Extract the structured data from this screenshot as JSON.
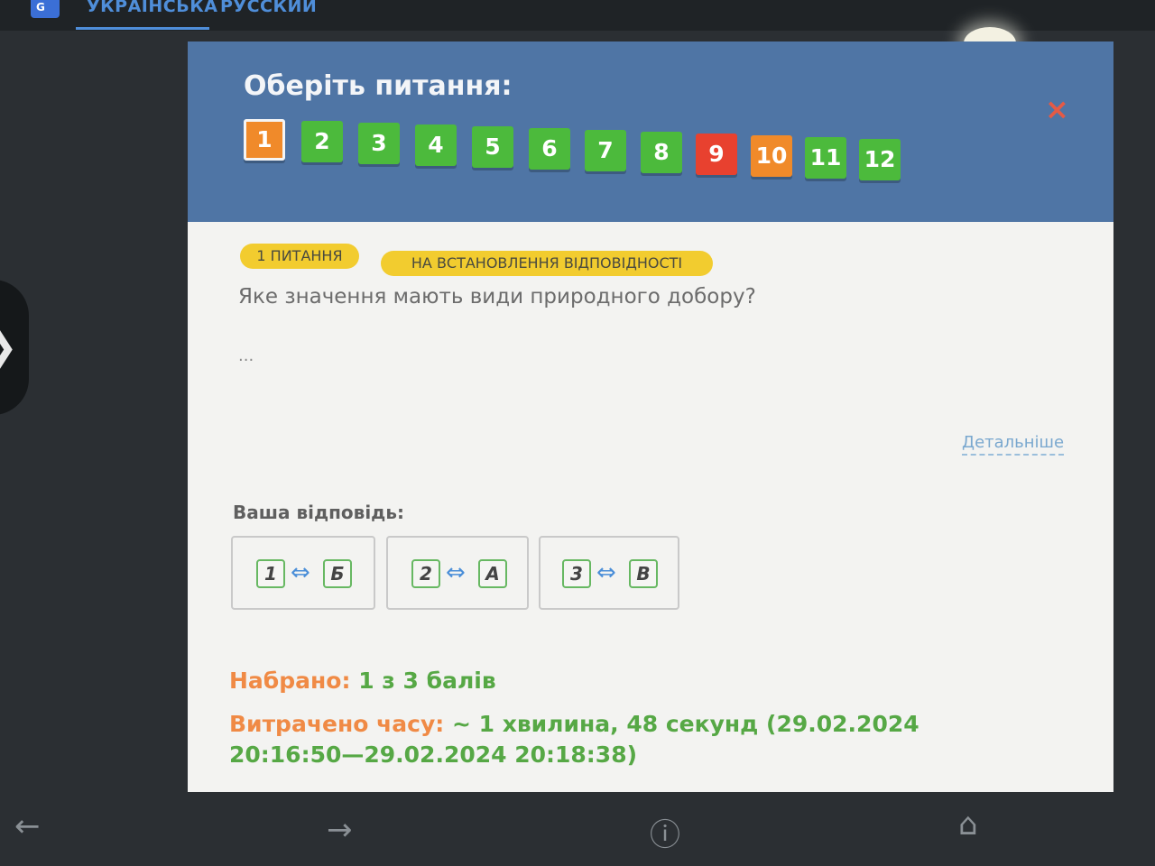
{
  "top_bar": {
    "languages": [
      "УКРАЇНСЬКА",
      "РУССКИЙ"
    ],
    "lang_icon": "G"
  },
  "modal": {
    "title": "Оберіть питання:",
    "close_icon": "×",
    "question_numbers": [
      {
        "label": "1",
        "status": "partial",
        "current": true
      },
      {
        "label": "2",
        "status": "correct"
      },
      {
        "label": "3",
        "status": "correct"
      },
      {
        "label": "4",
        "status": "correct"
      },
      {
        "label": "5",
        "status": "correct"
      },
      {
        "label": "6",
        "status": "correct"
      },
      {
        "label": "7",
        "status": "correct"
      },
      {
        "label": "8",
        "status": "correct"
      },
      {
        "label": "9",
        "status": "wrong"
      },
      {
        "label": "10",
        "status": "partial"
      },
      {
        "label": "11",
        "status": "correct"
      },
      {
        "label": "12",
        "status": "correct"
      }
    ],
    "badges": [
      "1 ПИТАННЯ",
      "НА ВСТАНОВЛЕННЯ ВІДПОВІДНОСТІ"
    ],
    "question_text": "Яке значення мають види природного добору?",
    "ellipsis": "...",
    "details_link": "Детальніше",
    "answer_label": "Ваша відповідь:",
    "pairs": [
      {
        "left": "1",
        "arrow": "⇔",
        "right": "Б"
      },
      {
        "left": "2",
        "arrow": "⇔",
        "right": "А"
      },
      {
        "left": "3",
        "arrow": "⇔",
        "right": "В"
      }
    ],
    "score_label": "Набрано:",
    "score_value": "1 з 3 балів",
    "time_label": "Витрачено часу:",
    "time_value": "~ 1 хвилина, 48 секунд (29.02.2024 20:16:50—29.02.2024 20:18:38)"
  },
  "colors": {
    "correct": "#4cba3c",
    "wrong": "#e8412f",
    "partial": "#f08a2a",
    "header": "#4f75a5",
    "badge": "#f2cc2f"
  },
  "bottom_nav": {
    "back_icon": "←",
    "forward_icon": "→",
    "info_icon": "ⓘ",
    "home_icon": "⌂"
  },
  "side": {
    "expand_icon": "❯"
  }
}
